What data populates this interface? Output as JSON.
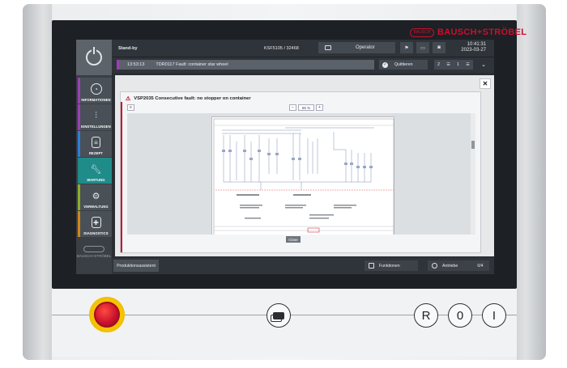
{
  "brand": {
    "name": "BAUSCH+STRÖBEL",
    "logo_text": "BAUSCH"
  },
  "topbar": {
    "state": "Stand-by",
    "machine": "KSF5105 / 32468",
    "operator_label": "Operator",
    "time": "10:41:31",
    "date": "2023-03-27"
  },
  "message": {
    "time": "13:53:13",
    "text": "TDR0117 Fault: container star wheel",
    "acknowledge": "Quittieren",
    "count_a": "2",
    "count_b": "1"
  },
  "nav": {
    "items": [
      {
        "label": "INFORMATIONEN",
        "icon": "gauge-icon",
        "color": "#9b3fb5"
      },
      {
        "label": "EINSTELLUNGEN",
        "icon": "sliders-icon",
        "color": "#9b3fb5"
      },
      {
        "label": "REZEPT",
        "icon": "document-icon",
        "color": "#2e7fd8"
      },
      {
        "label": "WARTUNG",
        "icon": "wrench-icon",
        "color": "#1f8c8a"
      },
      {
        "label": "VERWALTUNG",
        "icon": "gears-icon",
        "color": "#8fae2a"
      },
      {
        "label": "DIAGNOSTICS",
        "icon": "diagnostics-icon",
        "color": "#d1861a"
      }
    ],
    "footer_logo": "BAUSCH+STRÖBEL"
  },
  "dialog": {
    "title": "VSP2035 Consecutive fault: no stopper on container",
    "zoom": "55 %",
    "close_label": "Close"
  },
  "bottombar": {
    "tab": "Produktionsassistent",
    "functions": "Funktionen",
    "drives": "Antriebe",
    "drives_value": "0/4"
  },
  "keys": {
    "r": "R",
    "zero": "0",
    "one": "I"
  },
  "colors": {
    "accent_red": "#c8102e",
    "active_teal": "#1f8c8a"
  }
}
